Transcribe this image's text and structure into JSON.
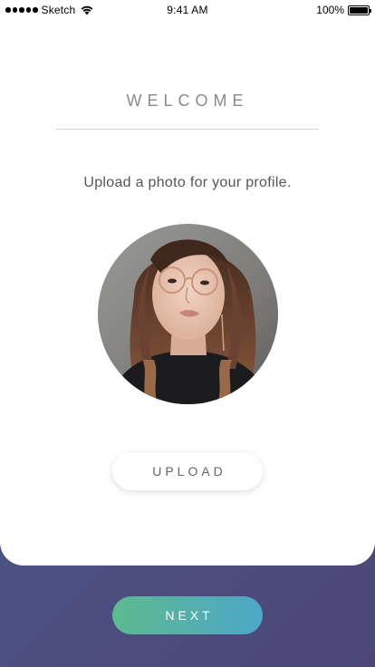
{
  "status_bar": {
    "carrier": "Sketch",
    "time": "9:41 AM",
    "battery": "100%",
    "icons": [
      "signal-dots-icon",
      "wifi-icon",
      "battery-icon"
    ]
  },
  "screen": {
    "heading": "WELCOME",
    "prompt": "Upload a photo for your profile.",
    "photo": {
      "description": "profile-photo",
      "shape": "circle"
    },
    "upload_label": "UPLOAD",
    "next_label": "NEXT"
  },
  "colors": {
    "background_gradient_start": "#4a5f8e",
    "background_gradient_end": "#4d4577",
    "next_gradient_start": "#5dba8e",
    "next_gradient_end": "#4ca7c9",
    "card": "#ffffff",
    "heading_text": "#8a8a8a",
    "prompt_text": "#555555"
  }
}
